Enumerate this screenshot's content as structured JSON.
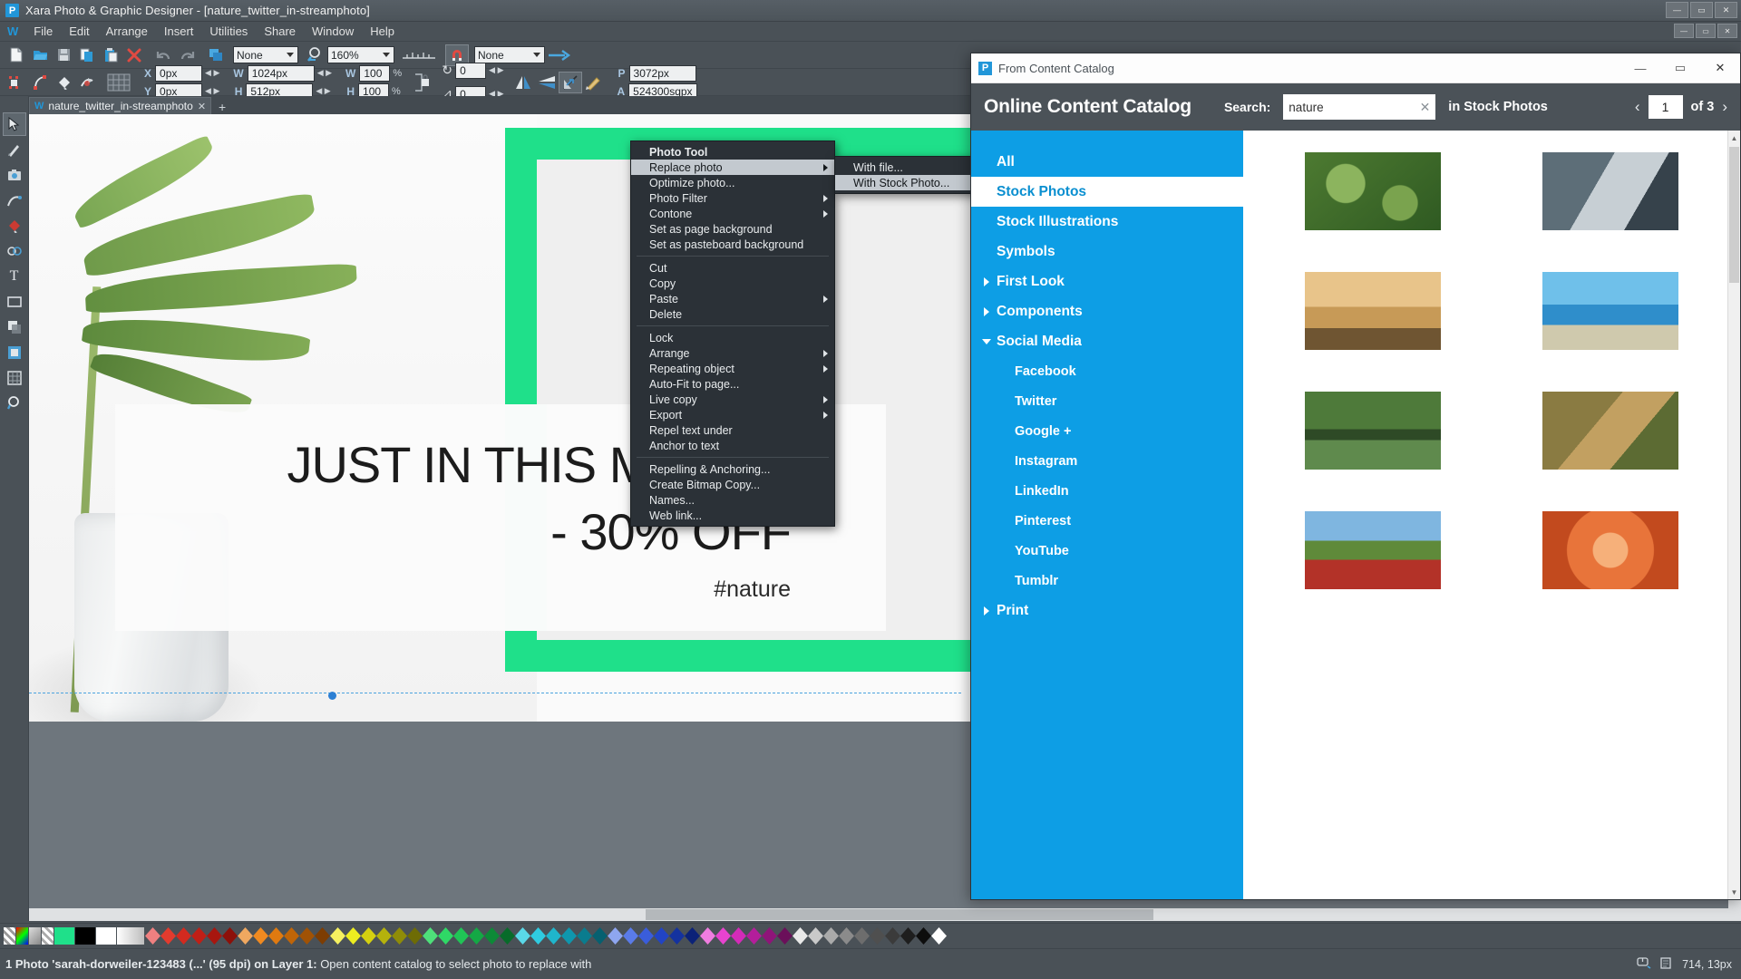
{
  "app": {
    "title": "Xara Photo & Graphic Designer - [nature_twitter_in-streamphoto]",
    "logo_letter": "P",
    "window_buttons": {
      "minimize": "—",
      "maximize": "▭",
      "close": "✕"
    }
  },
  "menubar": {
    "logo_letter": "W",
    "items": [
      "File",
      "Edit",
      "Arrange",
      "Insert",
      "Utilities",
      "Share",
      "Window",
      "Help"
    ],
    "doc_buttons": {
      "minimize": "—",
      "restore": "▭",
      "close": "✕"
    }
  },
  "toolbar1": {
    "icons": [
      "new-document-icon",
      "open-folder-icon",
      "save-icon",
      "copy-page-icon",
      "paste-page-icon",
      "delete-icon",
      "undo-icon",
      "redo-icon",
      "duplicate-icon"
    ],
    "quality_value": "None",
    "zoom_value": "160%",
    "ruler_icon": "ruler-icon",
    "magnet_icon": "magnet-snap-icon",
    "line_style_value": "None",
    "arrow_icon": "arrow-right-icon"
  },
  "toolbar2": {
    "x_label": "X",
    "x_value": "0px",
    "y_label": "Y",
    "y_value": "0px",
    "w_label": "W",
    "w_value": "1024px",
    "h_label": "H",
    "h_value": "512px",
    "wpct_label": "W",
    "wpct_value": "100",
    "wpct_unit": "%",
    "hpct_label": "H",
    "hpct_value": "100",
    "hpct_unit": "%",
    "rotate_value": "0",
    "skew_value": "0",
    "p_label": "P",
    "p_value": "3072px",
    "a_label": "A",
    "a_value": "524300sqpx",
    "icons": [
      "selector-nodes-icon",
      "shape-editor-icon",
      "fill-tool-icon",
      "transparency-tool-icon",
      "grid-table-icon",
      "lock-aspect-icon",
      "flip-horizontal-icon",
      "flip-vertical-icon",
      "diagonal-tool-icon",
      "paint-brush-icon"
    ]
  },
  "toolbox": {
    "tools": [
      {
        "name": "selector-tool",
        "glyph": "➤",
        "active": true
      },
      {
        "name": "shape-editor-tool",
        "glyph": "✎",
        "active": false
      },
      {
        "name": "photo-tool",
        "glyph": "◉",
        "active": false
      },
      {
        "name": "freehand-tool",
        "glyph": "✐",
        "active": false
      },
      {
        "name": "fill-tool",
        "glyph": "◐",
        "active": false
      },
      {
        "name": "blend-tool",
        "glyph": "❍",
        "active": false
      },
      {
        "name": "text-tool",
        "glyph": "T",
        "active": false
      },
      {
        "name": "rectangle-tool",
        "glyph": "▭",
        "active": false
      },
      {
        "name": "shadow-tool",
        "glyph": "▤",
        "active": false
      },
      {
        "name": "live-effects-tool",
        "glyph": "▣",
        "active": false
      },
      {
        "name": "push-tool",
        "glyph": "▦",
        "active": false
      },
      {
        "name": "zoom-tool",
        "glyph": "⌕",
        "active": false
      }
    ]
  },
  "document_tab": {
    "icon": "W",
    "label": "nature_twitter_in-streamphoto",
    "close": "✕",
    "add_tab": "+"
  },
  "canvas": {
    "headline_line1": "JUST IN THIS MONTH",
    "headline_line2": "- 30% OFF",
    "hashtag": "#nature",
    "accent_green": "#1fe08a",
    "mint": "#b6f4dc"
  },
  "context_menu": {
    "groups": [
      [
        {
          "label": "Photo Tool",
          "bold": true,
          "submenu": false,
          "highlight": false
        },
        {
          "label": "Replace photo",
          "bold": false,
          "submenu": true,
          "highlight": true
        },
        {
          "label": "Optimize photo...",
          "bold": false,
          "submenu": false,
          "highlight": false
        },
        {
          "label": "Photo Filter",
          "bold": false,
          "submenu": true,
          "highlight": false
        },
        {
          "label": "Contone",
          "bold": false,
          "submenu": true,
          "highlight": false
        },
        {
          "label": "Set as page background",
          "bold": false,
          "submenu": false,
          "highlight": false
        },
        {
          "label": "Set as pasteboard background",
          "bold": false,
          "submenu": false,
          "highlight": false
        }
      ],
      [
        {
          "label": "Cut",
          "bold": false,
          "submenu": false,
          "highlight": false
        },
        {
          "label": "Copy",
          "bold": false,
          "submenu": false,
          "highlight": false
        },
        {
          "label": "Paste",
          "bold": false,
          "submenu": true,
          "highlight": false
        },
        {
          "label": "Delete",
          "bold": false,
          "submenu": false,
          "highlight": false
        }
      ],
      [
        {
          "label": "Lock",
          "bold": false,
          "submenu": false,
          "highlight": false
        },
        {
          "label": "Arrange",
          "bold": false,
          "submenu": true,
          "highlight": false
        },
        {
          "label": "Repeating object",
          "bold": false,
          "submenu": true,
          "highlight": false
        },
        {
          "label": "Auto-Fit to page...",
          "bold": false,
          "submenu": false,
          "highlight": false
        },
        {
          "label": "Live copy",
          "bold": false,
          "submenu": true,
          "highlight": false
        },
        {
          "label": "Export",
          "bold": false,
          "submenu": true,
          "highlight": false
        },
        {
          "label": "Repel text under",
          "bold": false,
          "submenu": false,
          "highlight": false
        },
        {
          "label": "Anchor to text",
          "bold": false,
          "submenu": false,
          "highlight": false
        }
      ],
      [
        {
          "label": "Repelling & Anchoring...",
          "bold": false,
          "submenu": false,
          "highlight": false
        },
        {
          "label": "Create Bitmap Copy...",
          "bold": false,
          "submenu": false,
          "highlight": false
        },
        {
          "label": "Names...",
          "bold": false,
          "submenu": false,
          "highlight": false
        },
        {
          "label": "Web link...",
          "bold": false,
          "submenu": false,
          "highlight": false
        }
      ]
    ]
  },
  "submenu": {
    "items": [
      {
        "label": "With file...",
        "highlight": false
      },
      {
        "label": "With Stock Photo...",
        "highlight": true
      }
    ]
  },
  "dialog": {
    "titlebar": {
      "logo_letter": "P",
      "title": "From Content Catalog",
      "minimize": "—",
      "maximize": "▭",
      "close": "✕"
    },
    "heading": "Online Content Catalog",
    "search_label": "Search:",
    "search_value": "nature",
    "search_placeholder": "Search",
    "search_clear": "✕",
    "scope_label": "in Stock Photos",
    "prev_arrow": "‹",
    "next_arrow": "›",
    "page_number": "1",
    "page_of": "of 3",
    "categories": [
      {
        "label": "All",
        "level": 0,
        "state": "none",
        "selected": false
      },
      {
        "label": "Stock Photos",
        "level": 0,
        "state": "none",
        "selected": true
      },
      {
        "label": "Stock Illustrations",
        "level": 0,
        "state": "none",
        "selected": false
      },
      {
        "label": "Symbols",
        "level": 0,
        "state": "none",
        "selected": false
      },
      {
        "label": "First Look",
        "level": 0,
        "state": "collapsed",
        "selected": false
      },
      {
        "label": "Components",
        "level": 0,
        "state": "collapsed",
        "selected": false
      },
      {
        "label": "Social Media",
        "level": 0,
        "state": "expanded",
        "selected": false
      },
      {
        "label": "Facebook",
        "level": 1,
        "state": "none",
        "selected": false
      },
      {
        "label": "Twitter",
        "level": 1,
        "state": "none",
        "selected": false
      },
      {
        "label": "Google +",
        "level": 1,
        "state": "none",
        "selected": false
      },
      {
        "label": "Instagram",
        "level": 1,
        "state": "none",
        "selected": false
      },
      {
        "label": "LinkedIn",
        "level": 1,
        "state": "none",
        "selected": false
      },
      {
        "label": "Pinterest",
        "level": 1,
        "state": "none",
        "selected": false
      },
      {
        "label": "YouTube",
        "level": 1,
        "state": "none",
        "selected": false
      },
      {
        "label": "Tumblr",
        "level": 1,
        "state": "none",
        "selected": false
      },
      {
        "label": "Print",
        "level": 0,
        "state": "collapsed",
        "selected": false
      }
    ],
    "thumbnails": [
      {
        "name": "green-leaves-photo",
        "colors": [
          "#6b8f3d",
          "#3f6b28",
          "#96b85c"
        ]
      },
      {
        "name": "hand-phone-waterfall-photo",
        "colors": [
          "#4a5b66",
          "#2c3840",
          "#8fa3ad"
        ]
      },
      {
        "name": "sunset-skateboard-photo",
        "colors": [
          "#d8a martin",
          "#c9a063",
          "#8a6a3f"
        ]
      },
      {
        "name": "coastal-sea-cliff-photo",
        "colors": [
          "#4fa8dc",
          "#1f6fa8",
          "#dcd9c4"
        ]
      },
      {
        "name": "stone-bridge-river-photo",
        "colors": [
          "#4e7a3a",
          "#2f5325",
          "#7fa05c"
        ]
      },
      {
        "name": "leopard-rock-photo",
        "colors": [
          "#9c7b3c",
          "#5e6b33",
          "#c9a15a"
        ]
      },
      {
        "name": "red-poppies-field-photo",
        "colors": [
          "#c8382c",
          "#5f8a3a",
          "#7fb6e0"
        ]
      },
      {
        "name": "orange-rose-photo",
        "colors": [
          "#e8743a",
          "#f0a463",
          "#c24f22"
        ]
      }
    ]
  },
  "palette": {
    "icons": [
      "no-color-icon",
      "color-editor-icon",
      "color-picker-icon",
      "transparent-icon"
    ],
    "named_swatches": [
      "#1fe08a",
      "#000000",
      "#ffffff",
      "#d9d9d9"
    ]
  },
  "statusbar": {
    "selection_info": "1 Photo 'sarah-dorweiler-123483 (...' (95 dpi) on Layer 1:",
    "hint": "Open content catalog to select photo to replace with",
    "coords": "714, 13px",
    "icons": [
      "mouse-icon",
      "page-icon"
    ]
  }
}
